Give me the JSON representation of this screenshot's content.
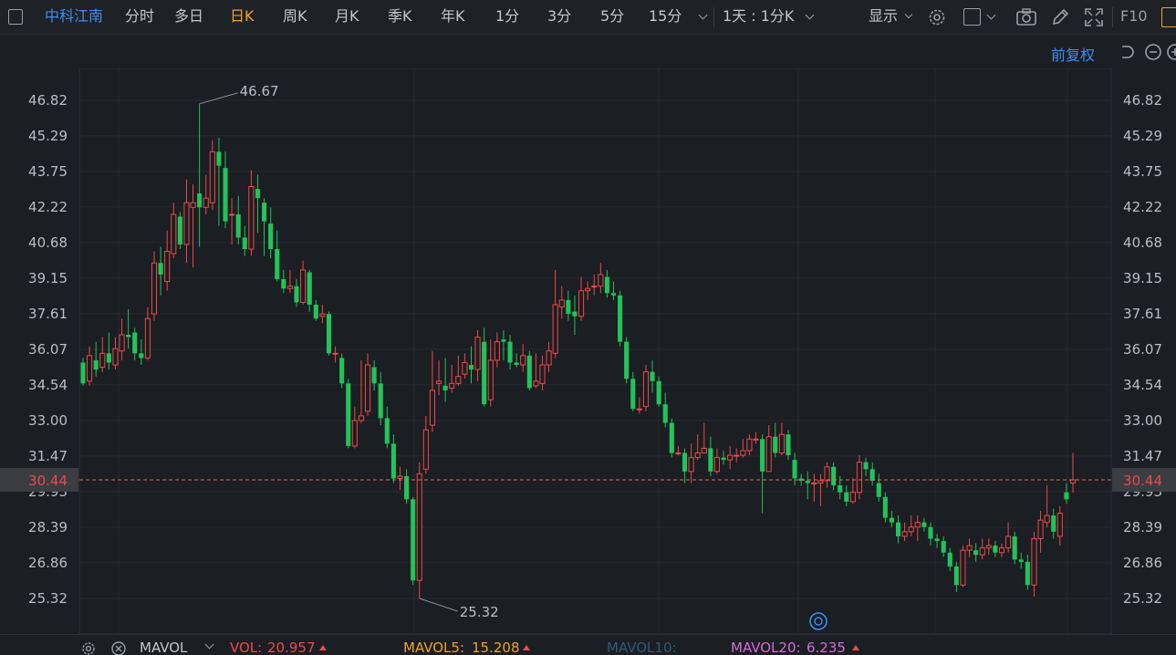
{
  "toolbar": {
    "stock_name": "中科江南",
    "periods": [
      "分时",
      "多日",
      "日K",
      "周K",
      "月K",
      "季K",
      "年K",
      "1分",
      "3分",
      "5分",
      "15分"
    ],
    "active_period": "日K",
    "interval_select": "1天 : 1分K",
    "display_label": "显示",
    "f10_label": "F10"
  },
  "subbar": {
    "adjust_label": "前复权"
  },
  "price_axis": {
    "ticks": [
      "46.82",
      "45.29",
      "43.75",
      "42.22",
      "40.68",
      "39.15",
      "37.61",
      "36.07",
      "34.54",
      "33.00",
      "31.47",
      "29.93",
      "28.39",
      "26.86",
      "25.32"
    ],
    "current_price": "30.44",
    "high_annotation": "46.67",
    "low_annotation": "25.32"
  },
  "bottom": {
    "indicator": "MAVOL",
    "vol": {
      "label": "VOL:",
      "value": "20.957"
    },
    "mavol5": {
      "label": "MAVOL5:",
      "value": "15.208"
    },
    "mavol10": {
      "label": "MAVOL10:",
      "value": ""
    },
    "mavol20": {
      "label": "MAVOL20:",
      "value": "6.235"
    }
  },
  "colors": {
    "up": "#ee4a4a",
    "down": "#22c35b",
    "accent": "#3d8df5",
    "active": "#f0a130",
    "price_line": "#ee6b4a"
  },
  "chart_data": {
    "type": "candlestick",
    "ylim": [
      24.5,
      47.9
    ],
    "high": 46.67,
    "low": 25.32,
    "last": 30.44,
    "candles": [
      [
        35.5,
        34.6,
        35.7,
        34.5
      ],
      [
        34.7,
        35.8,
        36.2,
        34.5
      ],
      [
        35.6,
        35.2,
        36.4,
        34.9
      ],
      [
        35.3,
        35.9,
        36.6,
        35.1
      ],
      [
        35.9,
        35.5,
        36.8,
        35.2
      ],
      [
        35.4,
        36.1,
        36.6,
        35.2
      ],
      [
        36.0,
        36.7,
        37.4,
        35.6
      ],
      [
        36.7,
        36.6,
        37.8,
        36.1
      ],
      [
        36.8,
        35.9,
        37.0,
        35.6
      ],
      [
        35.9,
        35.7,
        36.5,
        35.4
      ],
      [
        35.7,
        37.4,
        37.9,
        35.6
      ],
      [
        37.6,
        39.8,
        40.3,
        37.3
      ],
      [
        39.8,
        39.3,
        40.5,
        38.4
      ],
      [
        39.0,
        40.3,
        41.2,
        38.6
      ],
      [
        40.2,
        41.9,
        42.4,
        40.0
      ],
      [
        41.8,
        40.6,
        42.0,
        40.4
      ],
      [
        40.6,
        42.4,
        43.4,
        39.8
      ],
      [
        42.2,
        42.4,
        43.2,
        39.6
      ],
      [
        42.8,
        42.2,
        46.67,
        40.5
      ],
      [
        42.2,
        42.6,
        43.6,
        41.9
      ],
      [
        42.4,
        44.6,
        45.1,
        42.1
      ],
      [
        44.6,
        44.0,
        45.2,
        41.4
      ],
      [
        43.9,
        41.6,
        44.6,
        41.3
      ],
      [
        41.9,
        41.9,
        42.6,
        40.6
      ],
      [
        41.9,
        40.9,
        42.7,
        40.6
      ],
      [
        40.9,
        40.4,
        41.4,
        40.1
      ],
      [
        40.4,
        43.1,
        43.8,
        40.1
      ],
      [
        43.0,
        42.6,
        43.6,
        41.1
      ],
      [
        42.4,
        41.6,
        42.6,
        40.1
      ],
      [
        41.5,
        40.4,
        42.2,
        40.0
      ],
      [
        40.4,
        39.1,
        41.2,
        39.0
      ],
      [
        39.1,
        38.7,
        39.5,
        38.5
      ],
      [
        38.7,
        38.8,
        39.5,
        38.5
      ],
      [
        38.8,
        38.1,
        39.1,
        37.9
      ],
      [
        38.1,
        39.5,
        39.9,
        38.0
      ],
      [
        39.4,
        38.0,
        39.5,
        37.7
      ],
      [
        38.0,
        37.4,
        38.2,
        37.3
      ],
      [
        37.5,
        37.6,
        38.0,
        37.2
      ],
      [
        37.6,
        35.9,
        37.7,
        35.8
      ],
      [
        35.9,
        35.9,
        36.2,
        35.5
      ],
      [
        35.7,
        34.6,
        35.9,
        34.4
      ],
      [
        34.6,
        31.9,
        34.8,
        31.8
      ],
      [
        31.9,
        33.0,
        33.6,
        31.8
      ],
      [
        33.0,
        33.2,
        35.6,
        32.9
      ],
      [
        33.4,
        35.4,
        35.9,
        33.2
      ],
      [
        35.3,
        34.6,
        35.6,
        34.3
      ],
      [
        34.6,
        33.1,
        35.1,
        32.8
      ],
      [
        33.1,
        32.0,
        33.6,
        31.8
      ],
      [
        32.0,
        30.5,
        32.4,
        30.3
      ],
      [
        30.5,
        30.6,
        31.0,
        30.0
      ],
      [
        30.6,
        29.6,
        30.9,
        29.4
      ],
      [
        29.6,
        26.1,
        29.7,
        25.9
      ],
      [
        26.1,
        30.7,
        31.2,
        25.32
      ],
      [
        30.9,
        32.6,
        33.2,
        30.7
      ],
      [
        32.8,
        34.3,
        36.0,
        32.5
      ],
      [
        34.6,
        34.7,
        35.6,
        34.1
      ],
      [
        34.5,
        34.3,
        35.7,
        33.8
      ],
      [
        34.4,
        34.6,
        35.4,
        34.2
      ],
      [
        34.6,
        34.9,
        35.8,
        34.5
      ],
      [
        35.0,
        35.5,
        35.9,
        34.8
      ],
      [
        35.4,
        35.2,
        36.2,
        34.6
      ],
      [
        35.2,
        36.6,
        36.9,
        34.7
      ],
      [
        36.4,
        33.7,
        37.0,
        33.6
      ],
      [
        33.9,
        35.6,
        36.5,
        33.6
      ],
      [
        35.6,
        36.4,
        36.8,
        35.3
      ],
      [
        36.5,
        36.4,
        36.9,
        35.6
      ],
      [
        36.4,
        35.5,
        36.7,
        35.2
      ],
      [
        35.5,
        35.4,
        35.9,
        35.3
      ],
      [
        35.4,
        35.8,
        36.3,
        35.1
      ],
      [
        35.8,
        34.4,
        36.0,
        34.3
      ],
      [
        34.5,
        34.7,
        35.9,
        34.4
      ],
      [
        34.6,
        35.4,
        35.8,
        34.3
      ],
      [
        35.4,
        36.0,
        36.4,
        35.1
      ],
      [
        35.9,
        38.0,
        39.5,
        35.7
      ],
      [
        37.9,
        38.2,
        38.8,
        37.4
      ],
      [
        38.2,
        37.6,
        38.6,
        37.3
      ],
      [
        37.7,
        37.5,
        38.4,
        36.7
      ],
      [
        37.5,
        38.6,
        39.2,
        37.3
      ],
      [
        38.6,
        38.7,
        39.0,
        38.2
      ],
      [
        38.8,
        38.8,
        39.3,
        38.4
      ],
      [
        38.8,
        39.3,
        39.8,
        38.5
      ],
      [
        39.2,
        38.5,
        39.5,
        38.3
      ],
      [
        38.5,
        38.4,
        39.0,
        38.2
      ],
      [
        38.4,
        36.4,
        38.6,
        36.2
      ],
      [
        36.4,
        34.8,
        36.6,
        34.6
      ],
      [
        34.8,
        33.5,
        35.1,
        33.4
      ],
      [
        33.5,
        33.5,
        34.0,
        33.3
      ],
      [
        33.6,
        35.1,
        35.4,
        33.4
      ],
      [
        35.1,
        34.7,
        35.6,
        34.2
      ],
      [
        34.7,
        33.7,
        34.9,
        33.6
      ],
      [
        33.7,
        32.9,
        34.2,
        32.7
      ],
      [
        32.9,
        31.6,
        33.1,
        31.4
      ],
      [
        31.6,
        31.6,
        31.9,
        31.5
      ],
      [
        31.6,
        30.8,
        31.8,
        30.3
      ],
      [
        30.8,
        31.4,
        32.0,
        30.3
      ],
      [
        31.4,
        31.6,
        32.4,
        31.3
      ],
      [
        31.6,
        31.8,
        32.9,
        31.6
      ],
      [
        31.8,
        30.8,
        32.3,
        30.6
      ],
      [
        30.8,
        31.4,
        31.8,
        30.7
      ],
      [
        31.4,
        31.3,
        31.7,
        31.1
      ],
      [
        31.3,
        31.5,
        31.9,
        30.9
      ],
      [
        31.5,
        31.5,
        31.8,
        31.2
      ],
      [
        31.5,
        31.7,
        32.2,
        31.4
      ],
      [
        31.7,
        32.2,
        32.4,
        31.5
      ],
      [
        32.2,
        32.2,
        32.5,
        32.0
      ],
      [
        32.2,
        30.8,
        32.4,
        29.0
      ],
      [
        30.8,
        32.3,
        32.8,
        30.8
      ],
      [
        32.3,
        31.6,
        32.9,
        31.4
      ],
      [
        31.6,
        32.4,
        32.9,
        31.5
      ],
      [
        32.4,
        31.5,
        32.6,
        31.3
      ],
      [
        31.3,
        30.5,
        31.6,
        30.2
      ],
      [
        30.5,
        30.4,
        30.7,
        30.2
      ],
      [
        30.4,
        30.3,
        30.8,
        29.6
      ],
      [
        30.3,
        30.3,
        30.7,
        29.5
      ],
      [
        30.3,
        30.4,
        30.7,
        29.3
      ],
      [
        30.4,
        31.0,
        31.2,
        30.1
      ],
      [
        31.0,
        30.2,
        31.2,
        30.0
      ],
      [
        30.2,
        29.9,
        30.6,
        29.6
      ],
      [
        29.9,
        29.5,
        30.2,
        29.3
      ],
      [
        29.5,
        29.9,
        30.5,
        29.4
      ],
      [
        29.9,
        31.2,
        31.5,
        29.6
      ],
      [
        31.2,
        30.9,
        31.4,
        30.6
      ],
      [
        30.9,
        30.4,
        31.2,
        30.2
      ],
      [
        30.3,
        29.7,
        30.7,
        29.5
      ],
      [
        29.7,
        28.8,
        29.9,
        28.6
      ],
      [
        28.8,
        28.6,
        29.1,
        28.4
      ],
      [
        28.6,
        28.0,
        28.9,
        27.7
      ],
      [
        28.0,
        28.2,
        28.6,
        27.8
      ],
      [
        28.2,
        28.4,
        28.9,
        28.0
      ],
      [
        28.4,
        28.6,
        28.9,
        27.8
      ],
      [
        28.6,
        28.4,
        28.8,
        28.2
      ],
      [
        28.4,
        27.9,
        28.6,
        27.6
      ],
      [
        27.9,
        27.8,
        28.1,
        27.5
      ],
      [
        27.8,
        27.3,
        28.0,
        27.1
      ],
      [
        27.3,
        26.7,
        27.5,
        26.5
      ],
      [
        26.7,
        25.9,
        26.9,
        25.6
      ],
      [
        25.9,
        27.4,
        27.6,
        25.8
      ],
      [
        27.4,
        27.6,
        27.9,
        27.1
      ],
      [
        27.4,
        27.2,
        27.7,
        26.9
      ],
      [
        27.2,
        27.5,
        27.9,
        27.0
      ],
      [
        27.5,
        27.6,
        27.9,
        27.2
      ],
      [
        27.6,
        27.3,
        27.8,
        27.1
      ],
      [
        27.3,
        27.5,
        27.7,
        27.1
      ],
      [
        27.5,
        28.0,
        28.6,
        27.3
      ],
      [
        28.0,
        27.0,
        28.2,
        26.8
      ],
      [
        27.0,
        26.9,
        27.3,
        26.6
      ],
      [
        26.9,
        25.9,
        27.2,
        25.7
      ],
      [
        25.9,
        27.9,
        28.2,
        25.4
      ],
      [
        27.9,
        28.7,
        29.1,
        27.3
      ],
      [
        28.6,
        28.9,
        30.2,
        28.4
      ],
      [
        28.9,
        28.2,
        29.2,
        27.9
      ],
      [
        28.0,
        29.0,
        29.3,
        27.6
      ],
      [
        29.9,
        29.6,
        30.3,
        29.4
      ],
      [
        30.3,
        30.44,
        31.6,
        29.9
      ]
    ]
  }
}
